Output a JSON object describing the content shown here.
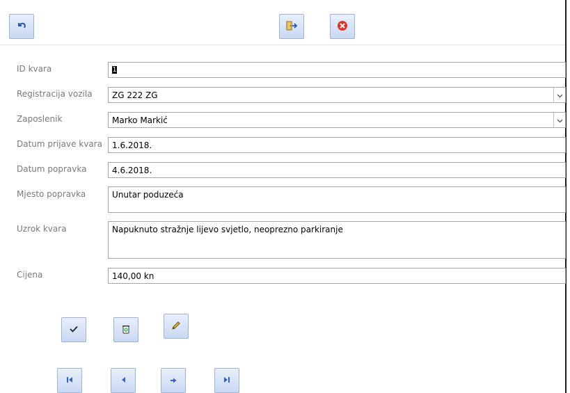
{
  "toolbar": {
    "undo_icon": "undo-icon",
    "exit_icon": "exit-door-icon",
    "close_icon": "close-icon"
  },
  "form": {
    "id_label": "ID kvara",
    "id_value": "1",
    "registration_label": "Registracija vozila",
    "registration_value": "ZG 222 ZG",
    "employee_label": "Zaposlenik",
    "employee_value": "Marko Markić",
    "report_date_label": "Datum prijave kvara",
    "report_date_value": "1.6.2018.",
    "repair_date_label": "Datum popravka",
    "repair_date_value": "4.6.2018.",
    "repair_place_label": "Mjesto popravka",
    "repair_place_value": "Unutar poduzeća",
    "cause_label": "Uzrok kvara",
    "cause_value": "Napuknuto stražnje lijevo svjetlo, neoprezno parkiranje",
    "price_label": "Cijena",
    "price_value": "140,00 kn"
  },
  "actions": {
    "save_icon": "checkmark-icon",
    "delete_icon": "recycle-bin-icon",
    "edit_icon": "pencil-icon"
  },
  "navigation": {
    "first_icon": "first-record-icon",
    "prev_icon": "previous-record-icon",
    "next_icon": "next-record-icon",
    "last_icon": "last-record-icon"
  },
  "colors": {
    "button_top": "#e9effb",
    "button_bottom": "#c9d8f2",
    "button_border": "#9fb3d6",
    "nav_icon": "#3a5fb5",
    "close_red": "#d9352a"
  }
}
